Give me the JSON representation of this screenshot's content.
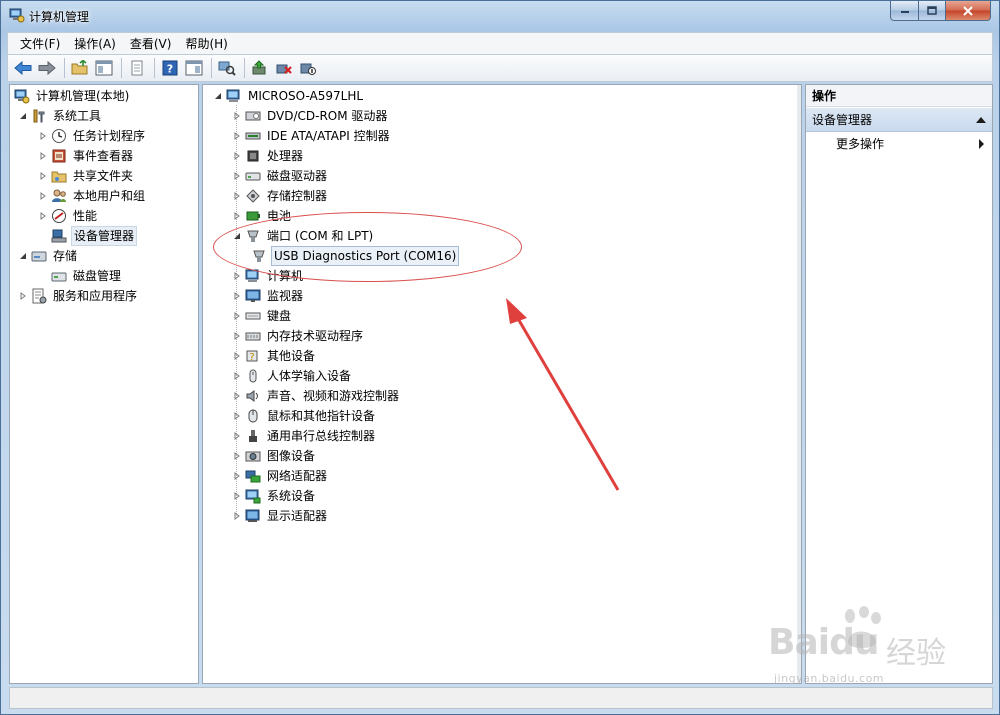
{
  "window": {
    "title": "计算机管理"
  },
  "menu": [
    "文件(F)",
    "操作(A)",
    "查看(V)",
    "帮助(H)"
  ],
  "nav": {
    "root": "计算机管理(本地)",
    "system_tools": "系统工具",
    "task_scheduler": "任务计划程序",
    "event_viewer": "事件查看器",
    "shared_folders": "共享文件夹",
    "local_users": "本地用户和组",
    "performance": "性能",
    "device_manager": "设备管理器",
    "storage": "存储",
    "disk_management": "磁盘管理",
    "services_apps": "服务和应用程序"
  },
  "devices": {
    "computer_name": "MICROSO-A597LHL",
    "categories": [
      "DVD/CD-ROM 驱动器",
      "IDE ATA/ATAPI 控制器",
      "处理器",
      "磁盘驱动器",
      "存储控制器",
      "电池",
      "端口 (COM 和 LPT)",
      "计算机",
      "监视器",
      "键盘",
      "内存技术驱动程序",
      "其他设备",
      "人体学输入设备",
      "声音、视频和游戏控制器",
      "鼠标和其他指针设备",
      "通用串行总线控制器",
      "图像设备",
      "网络适配器",
      "系统设备",
      "显示适配器"
    ],
    "port_child": "USB Diagnostics Port (COM16)"
  },
  "actions": {
    "header": "操作",
    "group": "设备管理器",
    "more": "更多操作"
  },
  "watermark": {
    "brand": "Baidu",
    "jingyan": "经验",
    "url": "jingyan.baidu.com"
  },
  "colors": {
    "annotation": "#d9504e",
    "selection": "#e8eef5"
  }
}
